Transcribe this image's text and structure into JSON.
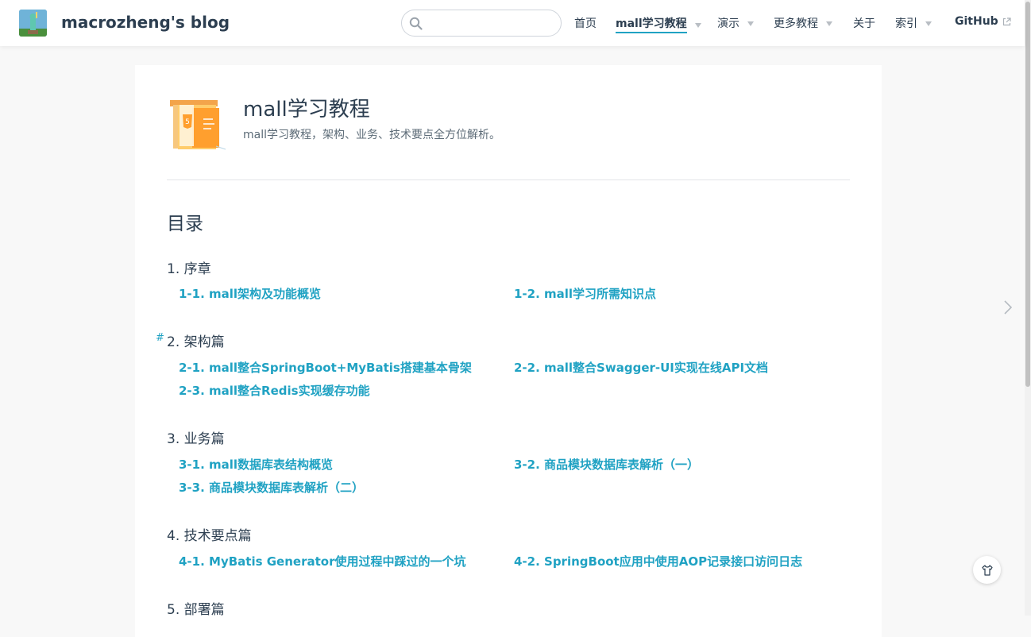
{
  "site": {
    "name": "macrozheng's blog"
  },
  "search": {
    "value": "",
    "placeholder": ""
  },
  "nav": {
    "items": [
      {
        "label": "首页"
      },
      {
        "label": "mall学习教程"
      },
      {
        "label": "演示"
      },
      {
        "label": "更多教程"
      },
      {
        "label": "关于"
      },
      {
        "label": "索引"
      },
      {
        "label": "GitHub"
      }
    ]
  },
  "page": {
    "title": "mall学习教程",
    "description": "mall学习教程，架构、业务、技术要点全方位解析。",
    "toc_heading": "目录",
    "anchor_symbol": "#"
  },
  "sections": [
    {
      "title": "1. 序章",
      "links": [
        "1-1. mall架构及功能概览",
        "1-2. mall学习所需知识点"
      ]
    },
    {
      "title": "2. 架构篇",
      "links": [
        "2-1. mall整合SpringBoot+MyBatis搭建基本骨架",
        "2-2. mall整合Swagger-UI实现在线API文档",
        "2-3. mall整合Redis实现缓存功能"
      ]
    },
    {
      "title": "3. 业务篇",
      "links": [
        "3-1. mall数据库表结构概览",
        "3-2. 商品模块数据库表解析（一）",
        "3-3. 商品模块数据库表解析（二）"
      ]
    },
    {
      "title": "4. 技术要点篇",
      "links": [
        "4-1. MyBatis Generator使用过程中踩过的一个坑",
        "4-2. SpringBoot应用中使用AOP记录接口访问日志"
      ]
    },
    {
      "title": "5. 部署篇",
      "links": []
    }
  ],
  "colors": {
    "accent": "#20a2c3",
    "text": "#2c3e50",
    "muted": "#5c6b77"
  }
}
